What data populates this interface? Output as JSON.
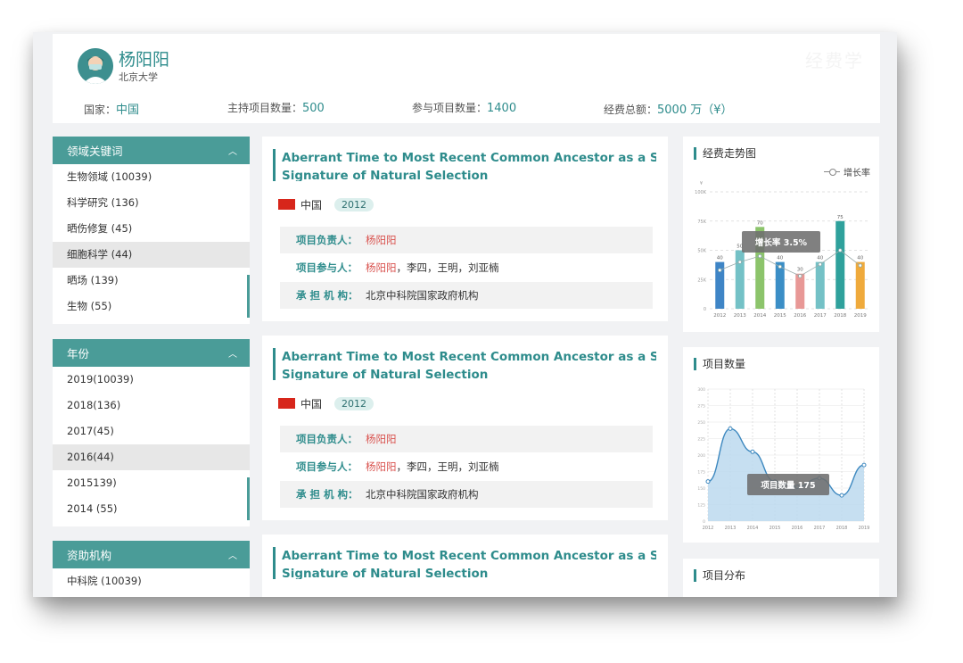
{
  "profile": {
    "name": "杨阳阳",
    "university": "北京大学",
    "watermark": "经费学",
    "stats": [
      {
        "label": "国家：",
        "value": "中国"
      },
      {
        "label": "主持项目数量：",
        "value": "500"
      },
      {
        "label": "参与项目数量：",
        "value": "1400"
      },
      {
        "label": "经费总额：",
        "value": "5000 万（¥）"
      }
    ]
  },
  "facets": [
    {
      "title": "领域关键词",
      "items": [
        "生物领域 (10039)",
        "科学研究 (136)",
        "晒伤修复 (45)",
        "细胞科学 (44)",
        "晒场 (139)",
        "生物 (55)"
      ],
      "selected": 3
    },
    {
      "title": "年份",
      "items": [
        "2019(10039)",
        "2018(136)",
        "2017(45)",
        "2016(44)",
        "2015139)",
        "2014 (55)"
      ],
      "selected": 3
    },
    {
      "title": "资助机构",
      "items": [
        "中科院 (10039)"
      ],
      "selected": -1
    }
  ],
  "projects": [
    {
      "title_line1": "Aberrant Time to Most Recent Common Ancestor as a Signa",
      "title_line2": "Signature of Natural Selection",
      "country": "中国",
      "year": "2012",
      "leader_label": "项目负责人：",
      "leader": "杨阳阳",
      "members_label": "项目参与人：",
      "members_highlight": "杨阳阳",
      "members_rest": "，李四，王明，刘亚楠",
      "org_label": "承 担 机 构：",
      "org": "北京中科院国家政府机构"
    },
    {
      "title_line1": "Aberrant Time to Most Recent Common Ancestor as a Signa",
      "title_line2": "Signature of Natural Selection",
      "country": "中国",
      "year": "2012",
      "leader_label": "项目负责人：",
      "leader": "杨阳阳",
      "members_label": "项目参与人：",
      "members_highlight": "杨阳阳",
      "members_rest": "，李四，王明，刘亚楠",
      "org_label": "承 担 机 构：",
      "org": "北京中科院国家政府机构"
    },
    {
      "title_line1": "Aberrant Time to Most Recent Common Ancestor as a Signa",
      "title_line2": "Signature of Natural Selection"
    }
  ],
  "panels": {
    "funding_title": "经费走势图",
    "count_title": "项目数量",
    "distribution_title": "项目分布",
    "legend_label": "增长率",
    "funding_tooltip": "增长率  3.5%",
    "count_tooltip": "项目数量  175"
  },
  "chart_data": [
    {
      "type": "bar",
      "title": "经费走势图",
      "categories": [
        "2012",
        "2013",
        "2014",
        "2015",
        "2016",
        "2017",
        "2018",
        "2019"
      ],
      "y_unit_label": "¥",
      "y_ticks": [
        "0",
        "25K",
        "50K",
        "75K",
        "100K"
      ],
      "ylim": [
        0,
        100
      ],
      "series": [
        {
          "values": [
            40,
            50,
            70,
            40,
            30,
            40,
            75,
            40
          ],
          "labels": [
            "40",
            "50",
            "70",
            "40",
            "30",
            "40",
            "75",
            "40"
          ]
        },
        {
          "name": "增长率",
          "type": "line",
          "values": [
            33,
            40,
            45,
            36,
            28,
            38,
            50,
            37
          ]
        }
      ],
      "colors": [
        "#3f85c6",
        "#74c1c6",
        "#8cc46b",
        "#3b8ec6",
        "#e89896",
        "#74c1c6",
        "#2fa19c",
        "#efaa3c"
      ],
      "legend": "top-right",
      "grid": true
    },
    {
      "type": "area",
      "title": "项目数量",
      "x": [
        "2012",
        "2013",
        "2014",
        "2015",
        "2016",
        "2017",
        "2018",
        "2019"
      ],
      "y_ticks": [
        "0",
        "125",
        "150",
        "175",
        "200",
        "225",
        "250",
        "275",
        "300"
      ],
      "series": [
        {
          "name": "项目数量",
          "values": [
            160,
            240,
            205,
            160,
            152,
            165,
            139,
            185
          ]
        }
      ],
      "grid": true
    }
  ]
}
